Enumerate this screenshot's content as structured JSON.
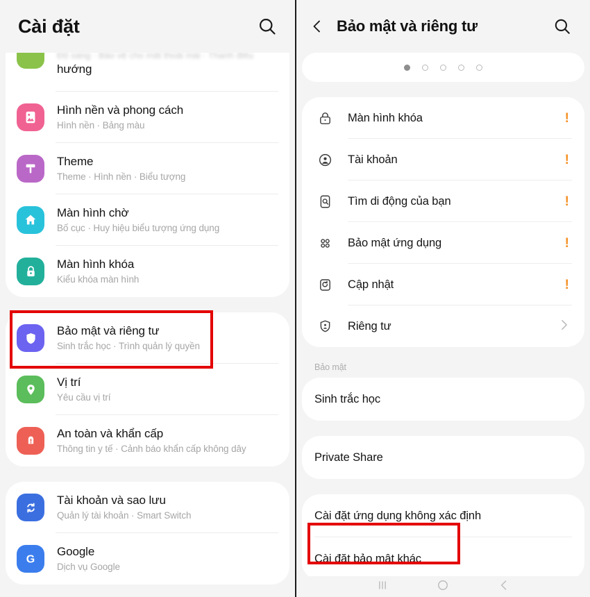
{
  "left_panel": {
    "header": {
      "title": "Cài đặt",
      "search_icon": "search-icon"
    },
    "clipped_row": {
      "blurred_text": "Độ sáng · Bảo vệ cho mắt thoải mái · Thanh điều",
      "visible_text": "hướng"
    },
    "groups": [
      {
        "items": [
          {
            "title": "Hình nền và phong cách",
            "subtitle": "Hình nền  ·  Bảng màu",
            "icon": "wallpaper-icon",
            "color": "#F06292"
          },
          {
            "title": "Theme",
            "subtitle": "Theme  ·  Hình nền  ·  Biểu tượng",
            "icon": "theme-brush-icon",
            "color": "#BA68C8"
          },
          {
            "title": "Màn hình chờ",
            "subtitle": "Bố cục  ·  Huy hiệu biểu tượng ứng dụng",
            "icon": "home-screen-icon",
            "color": "#29C2DB"
          },
          {
            "title": "Màn hình khóa",
            "subtitle": "Kiểu khóa màn hình",
            "icon": "lock-icon",
            "color": "#22B09B"
          }
        ]
      },
      {
        "items": [
          {
            "title": "Bảo mật và riêng tư",
            "subtitle": "Sinh trắc học  ·  Trình quản lý quyền",
            "icon": "shield-icon",
            "color": "#6C63F0",
            "highlighted": true
          },
          {
            "title": "Vị trí",
            "subtitle": "Yêu cầu vị trí",
            "icon": "location-pin-icon",
            "color": "#5BBD5B"
          },
          {
            "title": "An toàn và khẩn cấp",
            "subtitle": "Thông tin y tế  ·  Cảnh báo khẩn cấp không dây",
            "icon": "emergency-icon",
            "color": "#EE6055"
          }
        ]
      },
      {
        "items": [
          {
            "title": "Tài khoản và sao lưu",
            "subtitle": "Quản lý tài khoản  ·  Smart Switch",
            "icon": "sync-accounts-icon",
            "color": "#3B6FE0"
          },
          {
            "title": "Google",
            "subtitle": "Dịch vụ Google",
            "icon": "google-g-icon",
            "color": "#3B7DED"
          }
        ]
      }
    ]
  },
  "right_panel": {
    "header": {
      "back_icon": "back-chevron-icon",
      "title": "Bảo mật và riêng tư",
      "search_icon": "search-icon"
    },
    "page_dots": {
      "total": 5,
      "active_index": 0
    },
    "status_items": [
      {
        "title": "Màn hình khóa",
        "icon": "lock-outline-icon",
        "badge": "!"
      },
      {
        "title": "Tài khoản",
        "icon": "account-circle-icon",
        "badge": "!"
      },
      {
        "title": "Tìm di động của bạn",
        "icon": "find-my-mobile-icon",
        "badge": "!"
      },
      {
        "title": "Bảo mật ứng dụng",
        "icon": "app-grid-icon",
        "badge": "!"
      },
      {
        "title": "Cập nhật",
        "icon": "update-refresh-icon",
        "badge": "!"
      },
      {
        "title": "Riêng tư",
        "icon": "privacy-shield-icon",
        "chevron": "chevron-right-icon"
      }
    ],
    "section_label": "Bảo mật",
    "biometrics_items": [
      {
        "title": "Sinh trắc học"
      }
    ],
    "private_share_items": [
      {
        "title": "Private Share"
      }
    ],
    "other_items": [
      {
        "title": "Cài đặt ứng dụng không xác định"
      },
      {
        "title": "Cài đặt bảo mật khác",
        "highlighted": true
      }
    ],
    "nav_bar": {
      "recents": "recents-icon",
      "home": "home-icon",
      "back": "back-icon"
    }
  },
  "highlight_color": "#E30000",
  "badge_color": "#F59023"
}
